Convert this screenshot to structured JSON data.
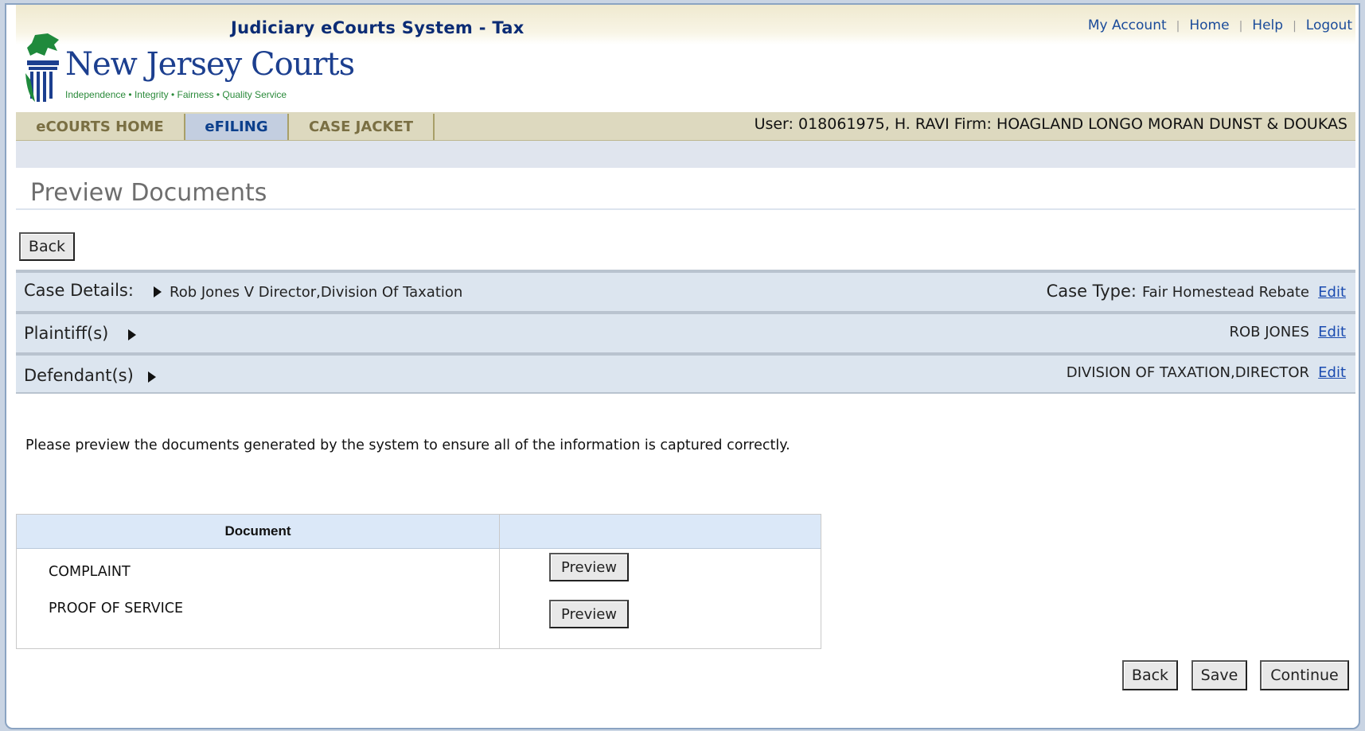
{
  "header": {
    "app_title": "Judiciary eCourts System - Tax",
    "links": [
      "My Account",
      "Home",
      "Help",
      "Logout"
    ],
    "logo_text": "New Jersey Courts",
    "logo_tagline": "Independence • Integrity • Fairness • Quality Service"
  },
  "nav": {
    "tabs": [
      "eCOURTS HOME",
      "eFILING",
      "CASE JACKET"
    ],
    "active_tab": "eFILING",
    "user_info": "User: 018061975, H. RAVI  Firm: HOAGLAND LONGO MORAN DUNST & DOUKAS"
  },
  "page": {
    "title": "Preview Documents",
    "back_label": "Back"
  },
  "case_details": {
    "label": "Case Details:",
    "value": "Rob Jones V Director,Division Of Taxation",
    "case_type_label": "Case Type:",
    "case_type_value": "Fair Homestead Rebate",
    "edit_label": "Edit"
  },
  "plaintiffs": {
    "label": "Plaintiff(s)",
    "value": "ROB JONES",
    "edit_label": "Edit"
  },
  "defendants": {
    "label": "Defendant(s)",
    "value": "DIVISION OF TAXATION,DIRECTOR",
    "edit_label": "Edit"
  },
  "instructions": "Please preview the documents generated by the system to ensure all of the information is captured correctly.",
  "documents": {
    "header": "Document",
    "rows": [
      {
        "name": "COMPLAINT",
        "action": "Preview"
      },
      {
        "name": "PROOF OF SERVICE",
        "action": "Preview"
      }
    ]
  },
  "footer_buttons": {
    "back": "Back",
    "save": "Save",
    "continue": "Continue"
  },
  "colors": {
    "nav_active": "#c3cee0",
    "section_row": "#dce5ef",
    "link": "#1a4bb0",
    "brand_blue": "#0b2c75"
  }
}
